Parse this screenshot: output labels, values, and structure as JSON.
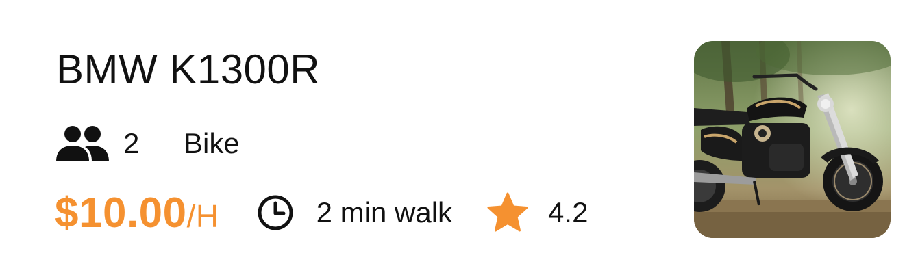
{
  "listing": {
    "title": "BMW K1300R",
    "capacity": "2",
    "vehicle_type": "Bike",
    "price": "$10.00",
    "price_unit": "/H",
    "walk_time": "2 min walk",
    "rating": "4.2",
    "icons": {
      "capacity": "people-icon",
      "walk": "clock-icon",
      "rating": "star-icon"
    },
    "colors": {
      "accent": "#f59130",
      "text": "#111111"
    }
  }
}
